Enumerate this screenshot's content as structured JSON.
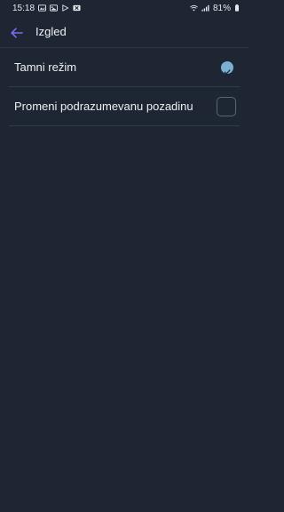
{
  "status_bar": {
    "time": "15:18",
    "battery": "81%",
    "left_icons": [
      "gallery-icon",
      "image-icon",
      "play-store-icon",
      "tool-icon"
    ],
    "right_icons": [
      "wifi-icon",
      "signal-icon",
      "battery-icon"
    ]
  },
  "app_bar": {
    "title": "Izgled",
    "back_icon": "arrow-left-icon",
    "accent": "#7c6cf2"
  },
  "settings": {
    "items": [
      {
        "label": "Tamni režim",
        "checked": true
      },
      {
        "label": "Promeni podrazumevanu pozadinu",
        "checked": false
      }
    ]
  },
  "colors": {
    "background": "#1f2633",
    "check_accent": "#7bb0d4"
  }
}
